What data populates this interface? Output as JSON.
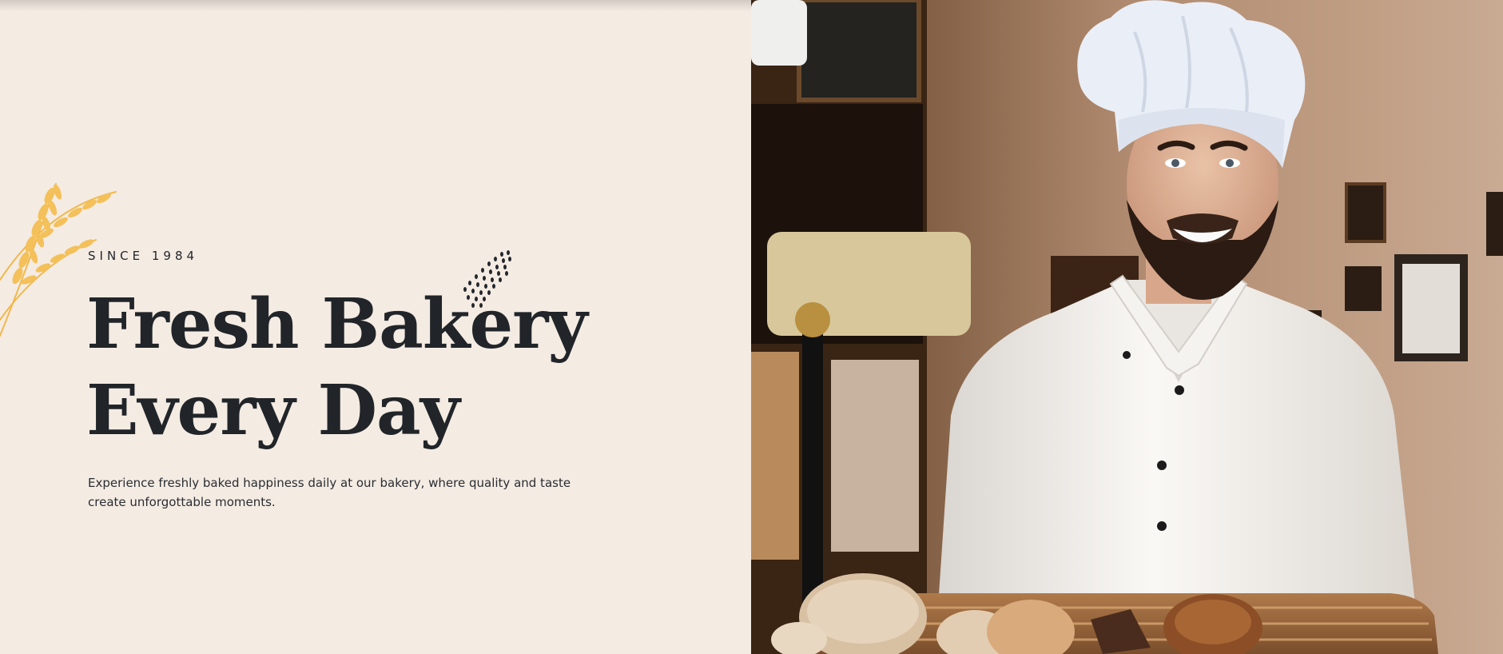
{
  "hero": {
    "eyebrow": "SINCE 1984",
    "headline_line1": "Fresh Bakery",
    "headline_line2": "Every Day",
    "description": "Experience freshly baked happiness daily at our bakery, where quality and taste create unforgottable moments."
  },
  "decor": {
    "wheat_icon": "wheat-icon",
    "seeds_icon": "seeds-icon"
  },
  "colors": {
    "background": "#f4ebe3",
    "heading": "#212529",
    "wheat": "#f2b84b"
  }
}
